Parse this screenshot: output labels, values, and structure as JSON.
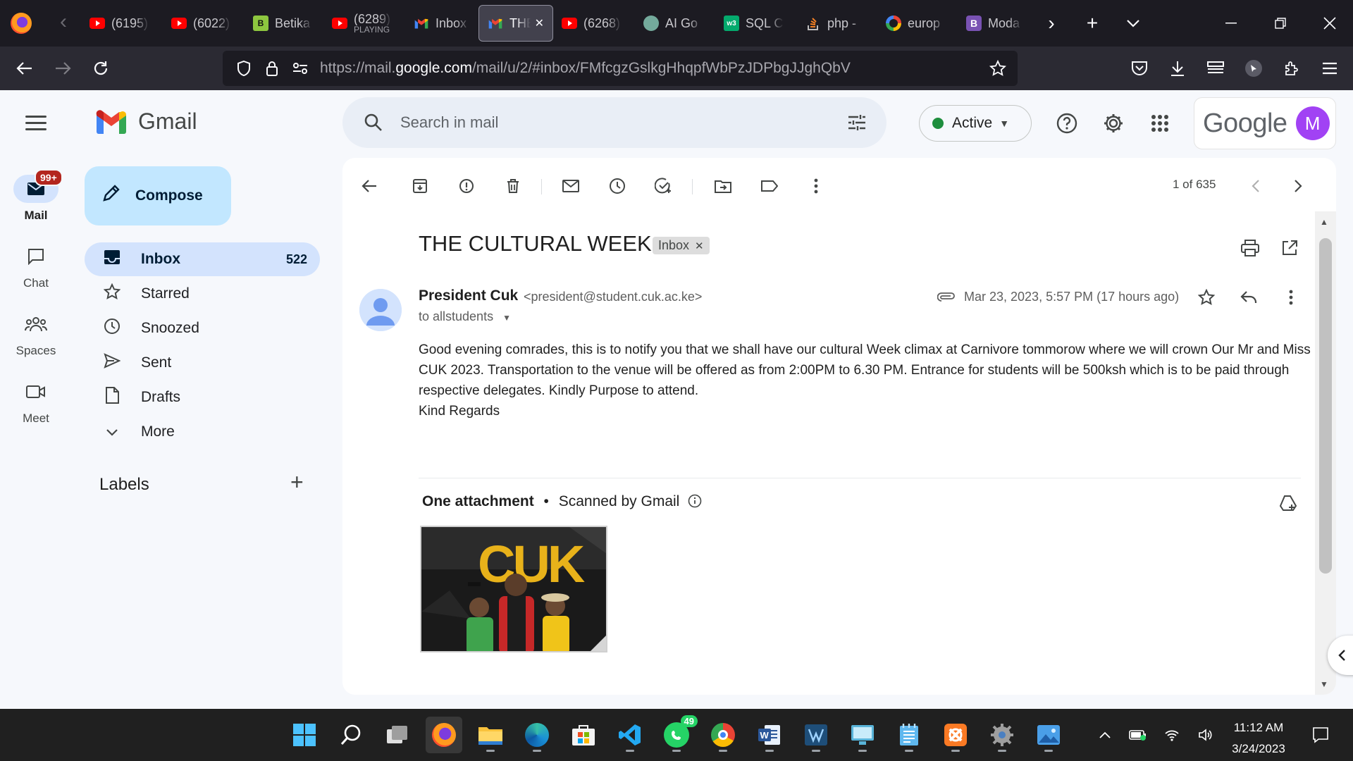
{
  "browser": {
    "tabs": [
      {
        "title": "(6195)",
        "sub": "",
        "icon": "youtube-icon",
        "color": "#ff0000"
      },
      {
        "title": "(6022)",
        "sub": "",
        "icon": "youtube-icon",
        "color": "#ff0000"
      },
      {
        "title": "Betika",
        "sub": "",
        "icon": "betika-icon",
        "color": "#8dc63f"
      },
      {
        "title": "(6289)",
        "sub": "PLAYING",
        "icon": "youtube-icon",
        "color": "#ff0000"
      },
      {
        "title": "Inbox",
        "sub": "",
        "icon": "gmail-icon",
        "color": "#ea4335"
      },
      {
        "title": "THE",
        "sub": "",
        "icon": "gmail-icon",
        "color": "#ea4335"
      },
      {
        "title": "(6268)",
        "sub": "",
        "icon": "youtube-icon",
        "color": "#ff0000"
      },
      {
        "title": "AI Go",
        "sub": "",
        "icon": "openai-icon",
        "color": "#74aa9c"
      },
      {
        "title": "SQL C",
        "sub": "",
        "icon": "w3schools-icon",
        "color": "#04aa6d"
      },
      {
        "title": "php -",
        "sub": "",
        "icon": "stackoverflow-icon",
        "color": "#f48024"
      },
      {
        "title": "europ",
        "sub": "",
        "icon": "google-icon",
        "color": "#4285f4"
      },
      {
        "title": "Moda",
        "sub": "",
        "icon": "bootstrap-icon",
        "color": "#7952b3"
      }
    ],
    "url_prefix": "https://mail.",
    "url_host": "google.com",
    "url_path": "/mail/u/2/#inbox/FMfcgzGslkgHhqpfWbPzJDPbgJJghQbV"
  },
  "rail": {
    "mail": "Mail",
    "mail_badge": "99+",
    "chat": "Chat",
    "spaces": "Spaces",
    "meet": "Meet"
  },
  "brand": "Gmail",
  "compose": "Compose",
  "nav": [
    {
      "label": "Inbox",
      "count": "522",
      "icon": "inbox-icon"
    },
    {
      "label": "Starred",
      "count": "",
      "icon": "star-icon"
    },
    {
      "label": "Snoozed",
      "count": "",
      "icon": "clock-icon"
    },
    {
      "label": "Sent",
      "count": "",
      "icon": "send-icon"
    },
    {
      "label": "Drafts",
      "count": "",
      "icon": "draft-icon"
    },
    {
      "label": "More",
      "count": "",
      "icon": "chevron-down-icon"
    }
  ],
  "labels_heading": "Labels",
  "search": {
    "placeholder": "Search in mail"
  },
  "status": "Active",
  "google_word": "Google",
  "avatar_letter": "M",
  "pager": "1 of 635",
  "message": {
    "subject": "THE CULTURAL WEEK",
    "chip": "Inbox",
    "sender_name": "President Cuk",
    "sender_email": "<president@student.cuk.ac.ke>",
    "to": "to allstudents",
    "date": "Mar 23, 2023, 5:57 PM (17 hours ago)",
    "body": [
      "Good evening comrades, this is to notify you that we shall have our cultural Week climax at Carnivore  tommorow where we will crown Our Mr and Miss CUK 2023. Transportation to the venue will be offered as from 2:00PM to 6.30 PM. Entrance for students will be 500ksh which is to be paid through respective delegates. Kindly Purpose to attend.",
      "Kind Regards"
    ],
    "attachment_heading": "One attachment",
    "attachment_note": "Scanned by Gmail",
    "attachment_poster_text": "CUK"
  },
  "taskbar": {
    "whatsapp_badge": "49",
    "time": "11:12 AM",
    "date": "3/24/2023"
  },
  "colors": {
    "accent": "#0b57d0",
    "nav_active": "#d3e3fd",
    "compose": "#c2e7ff",
    "status_green": "#1e8e3e",
    "badge_red": "#b3261e",
    "avatar_purple": "#a142f4"
  }
}
